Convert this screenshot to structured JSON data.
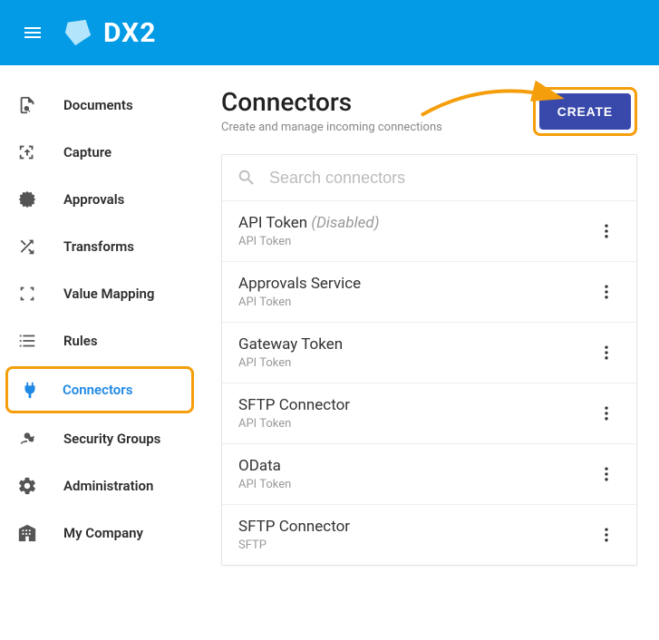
{
  "brand": "DX2",
  "sidebar": {
    "items": [
      {
        "label": "Documents",
        "icon": "document-search-icon"
      },
      {
        "label": "Capture",
        "icon": "capture-icon"
      },
      {
        "label": "Approvals",
        "icon": "approval-icon"
      },
      {
        "label": "Transforms",
        "icon": "shuffle-icon"
      },
      {
        "label": "Value Mapping",
        "icon": "collapse-icon"
      },
      {
        "label": "Rules",
        "icon": "list-icon"
      },
      {
        "label": "Connectors",
        "icon": "plug-icon",
        "active": true
      },
      {
        "label": "Security Groups",
        "icon": "users-key-icon"
      },
      {
        "label": "Administration",
        "icon": "gear-icon"
      },
      {
        "label": "My Company",
        "icon": "building-icon"
      }
    ]
  },
  "page": {
    "title": "Connectors",
    "subtitle": "Create and manage incoming connections",
    "create_label": "CREATE"
  },
  "search": {
    "placeholder": "Search connectors"
  },
  "connectors": [
    {
      "name": "API Token",
      "disabled_suffix": "(Disabled)",
      "type": "API Token"
    },
    {
      "name": "Approvals Service",
      "type": "API Token"
    },
    {
      "name": "Gateway Token",
      "type": "API Token"
    },
    {
      "name": "SFTP Connector",
      "type": "API Token"
    },
    {
      "name": "OData",
      "type": "API Token"
    },
    {
      "name": "SFTP Connector",
      "type": "SFTP"
    }
  ],
  "colors": {
    "topbar": "#039be5",
    "highlight": "#f59e0b",
    "create": "#3949ab",
    "active": "#1e88e5"
  }
}
